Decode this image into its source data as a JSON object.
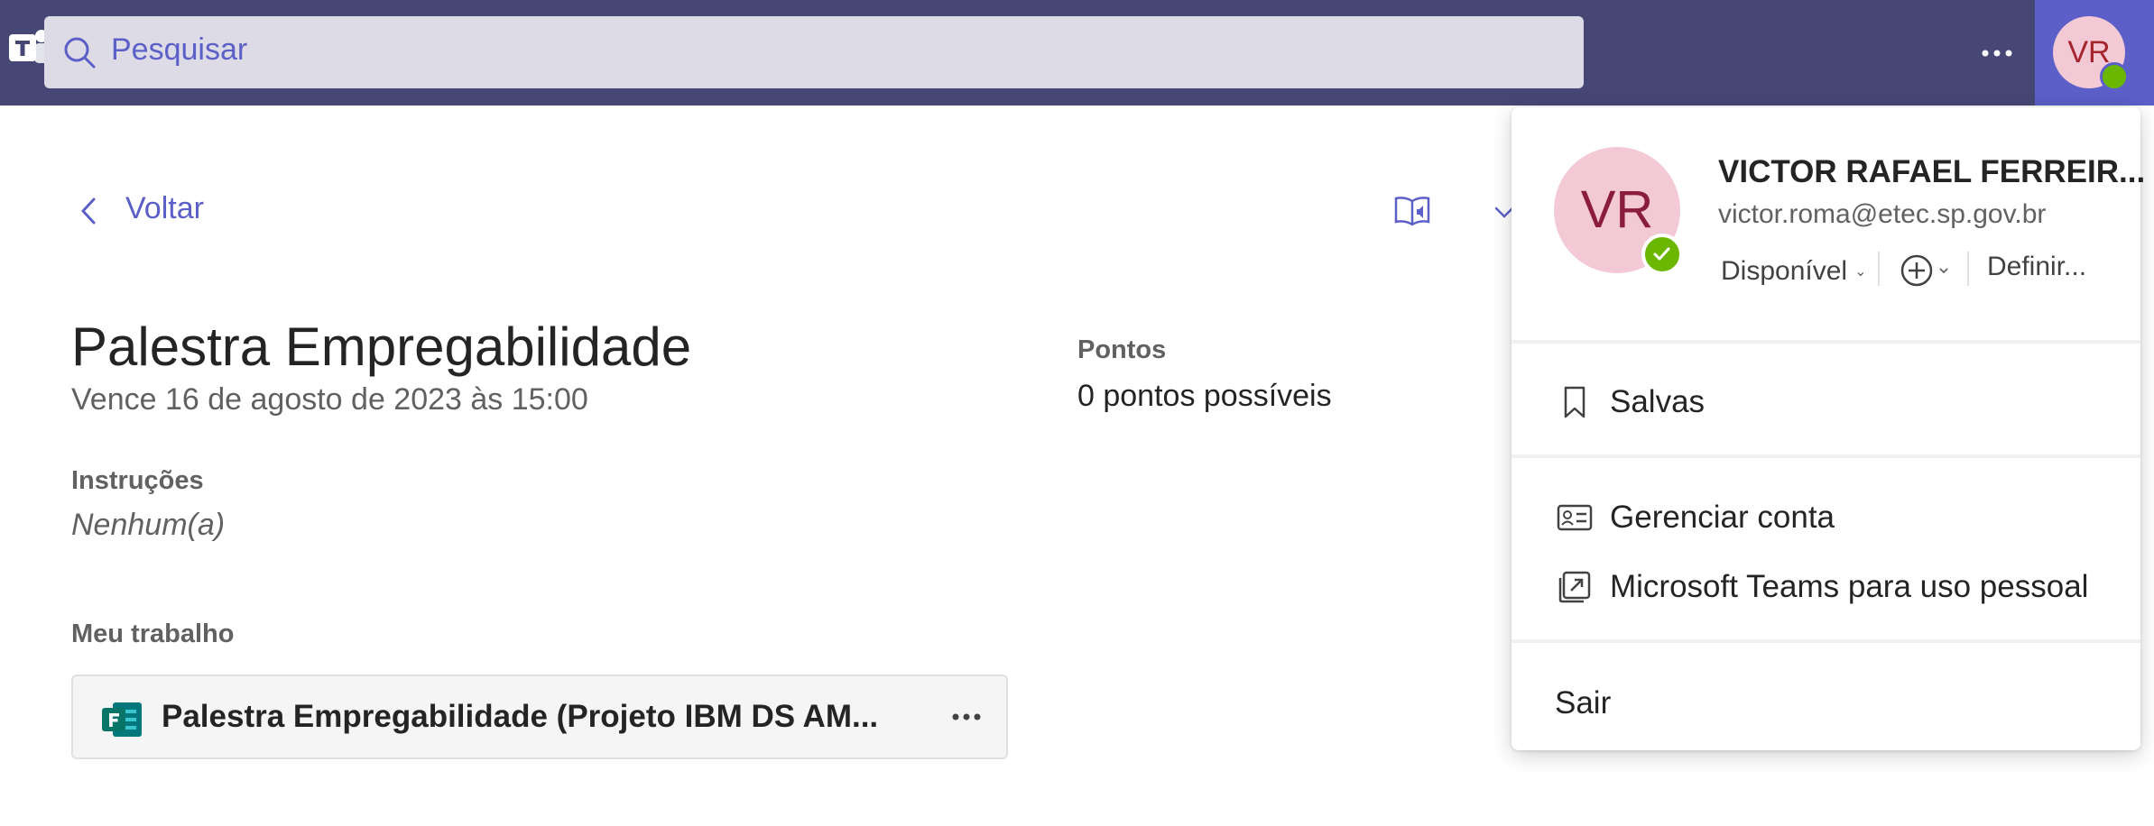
{
  "topbar": {
    "app_icon": "microsoft-teams-icon",
    "search_placeholder": "Pesquisar",
    "more_icon": "more-horizontal-icon",
    "avatar_initials": "VR"
  },
  "nav": {
    "back_label": "Voltar",
    "immersive_reader_icon": "immersive-reader-icon"
  },
  "assignment": {
    "title": "Palestra Empregabilidade",
    "due": "Vence 16 de agosto de 2023 às 15:00",
    "points_label": "Pontos",
    "points_value": "0 pontos possíveis",
    "instructions_label": "Instruções",
    "instructions_value": "Nenhum(a)",
    "my_work_label": "Meu trabalho",
    "work_item_name": "Palestra Empregabilidade (Projeto IBM DS AM..."
  },
  "profile": {
    "initials": "VR",
    "name": "VICTOR RAFAEL FERREIR...",
    "email": "victor.roma@etec.sp.gov.br",
    "status": "Disponível",
    "set_message": "Definir...",
    "menu": [
      {
        "label": "Salvas",
        "icon": "bookmark-icon"
      },
      {
        "label": "Gerenciar conta",
        "icon": "contact-card-icon"
      },
      {
        "label": "Microsoft Teams para uso pessoal",
        "icon": "open-external-icon"
      },
      {
        "label": "Sair"
      }
    ]
  },
  "colors": {
    "topbar": "#464775",
    "accent": "#5b5fc7",
    "presence": "#6bb700",
    "avatar_bg": "#f4c9d6"
  }
}
